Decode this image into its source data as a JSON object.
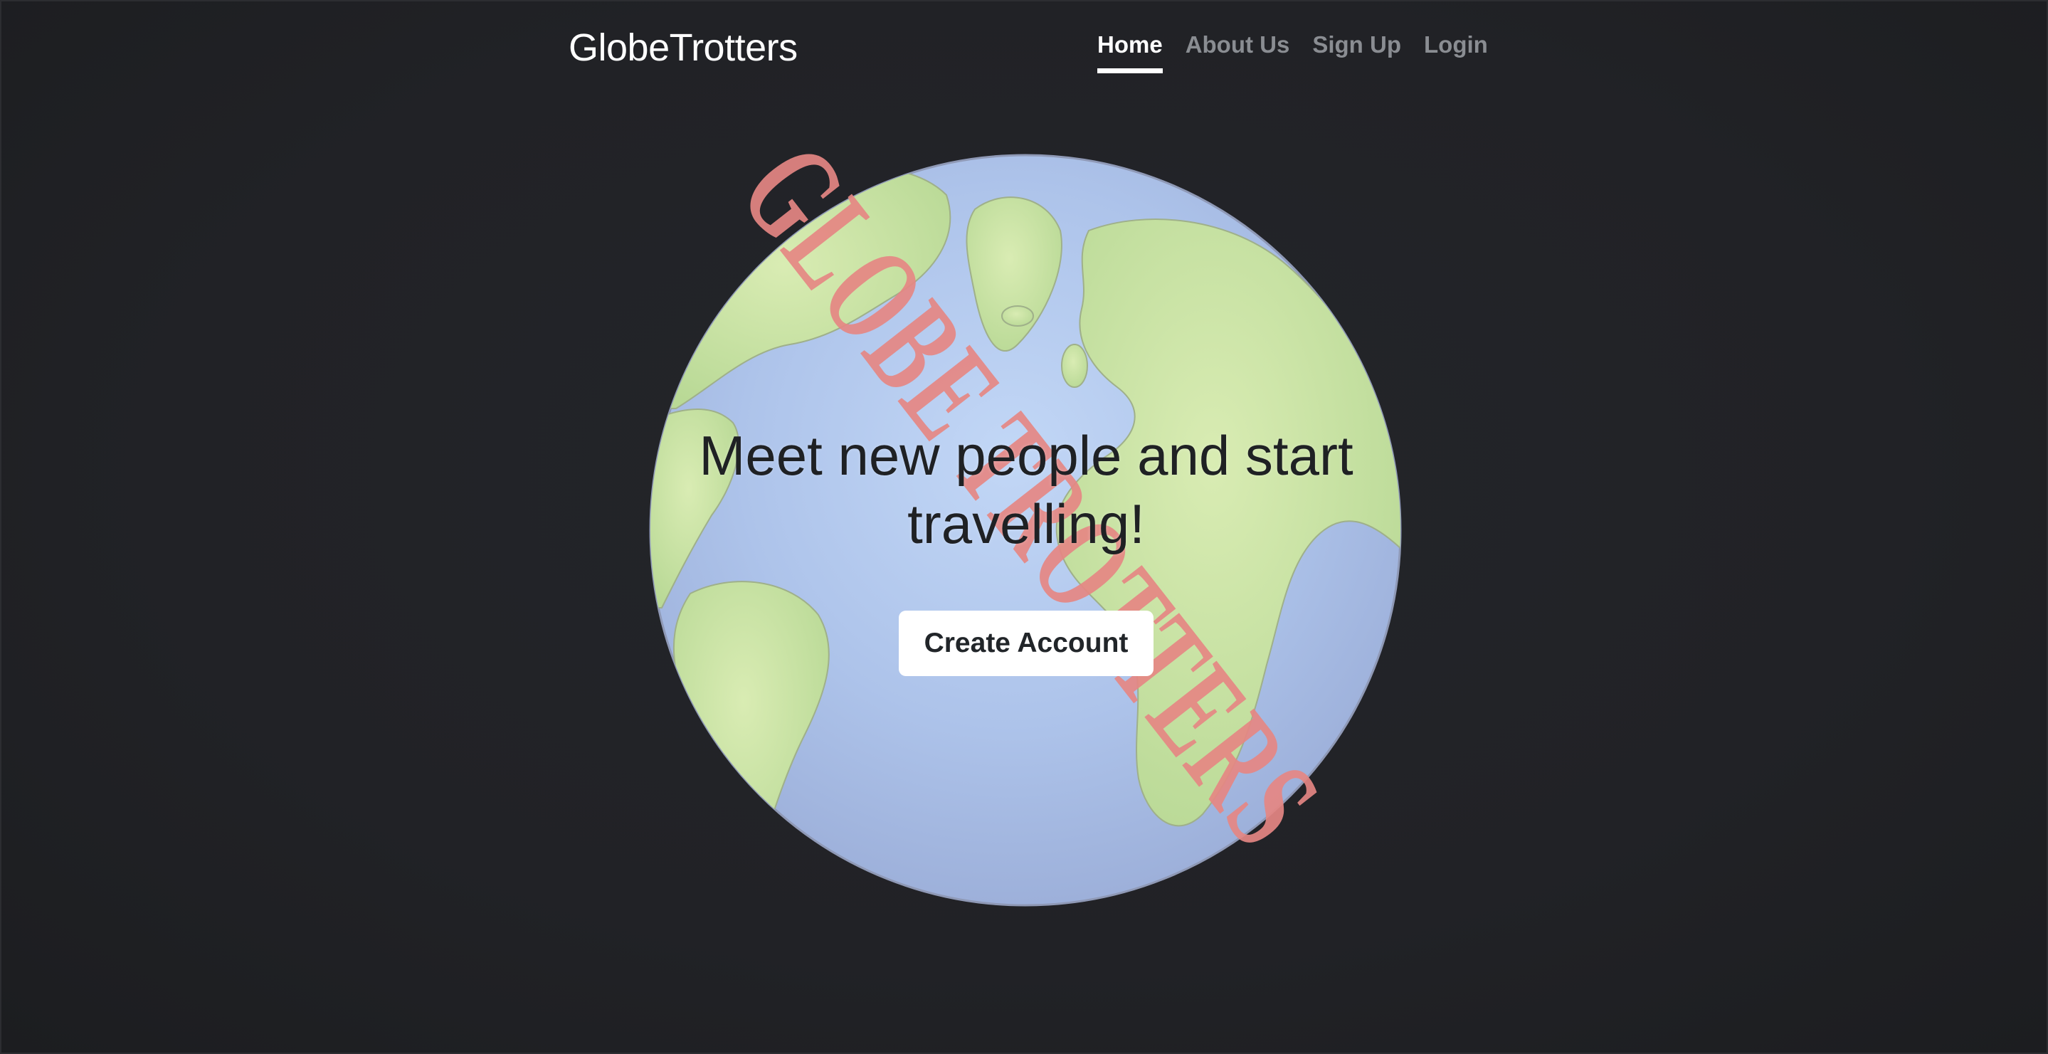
{
  "nav": {
    "brand": "GlobeTrotters",
    "links": [
      {
        "label": "Home",
        "active": true
      },
      {
        "label": "About Us",
        "active": false
      },
      {
        "label": "Sign Up",
        "active": false
      },
      {
        "label": "Login",
        "active": false
      }
    ]
  },
  "hero": {
    "title_line1": "Meet new people and start",
    "title_line2": "travelling!",
    "cta_label": "Create Account"
  },
  "stamp": {
    "text": "GLOBE TROTTERS",
    "color": "#e58783"
  },
  "colors": {
    "background": "#222327",
    "ocean": "#b7cdf2",
    "land": "#cfe6a7",
    "active_link": "#ffffff",
    "inactive_link": "#8a8d92"
  }
}
